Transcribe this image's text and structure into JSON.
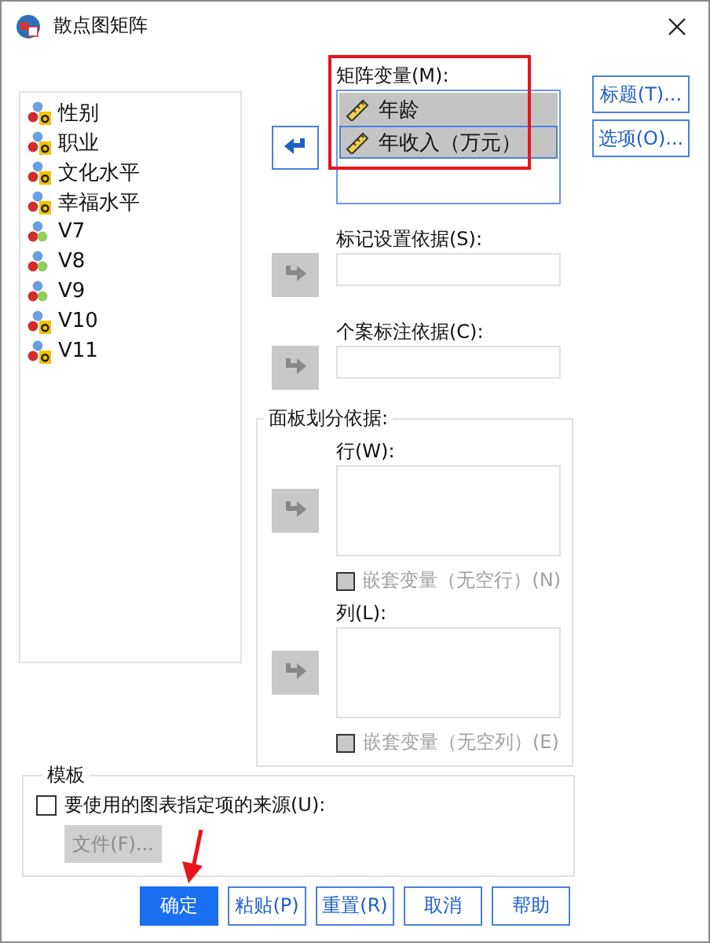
{
  "window": {
    "title": "散点图矩阵"
  },
  "variables": [
    {
      "name": "性别",
      "kind": "string"
    },
    {
      "name": "职业",
      "kind": "string"
    },
    {
      "name": "文化水平",
      "kind": "string"
    },
    {
      "name": "幸福水平",
      "kind": "string"
    },
    {
      "name": "V7",
      "kind": "nominal"
    },
    {
      "name": "V8",
      "kind": "nominal"
    },
    {
      "name": "V9",
      "kind": "nominal"
    },
    {
      "name": "V10",
      "kind": "string"
    },
    {
      "name": "V11",
      "kind": "string"
    }
  ],
  "matrix_variables": {
    "label": "矩阵变量(M):",
    "move_enabled": true,
    "items": [
      {
        "name": "年龄",
        "kind": "scale",
        "selected": true,
        "focused": false
      },
      {
        "name": "年收入（万元）",
        "kind": "scale",
        "selected": true,
        "focused": true
      }
    ]
  },
  "marker": {
    "label": "标记设置依据(S):",
    "move_enabled": false
  },
  "case_label": {
    "label": "个案标注依据(C):",
    "move_enabled": false
  },
  "panel": {
    "title": "面板划分依据:",
    "sections": [
      {
        "label": "行(W):",
        "move_enabled": false,
        "nest": {
          "label": "嵌套变量（无空行）(N)",
          "checked": false,
          "disabled": true
        }
      },
      {
        "label": "列(L):",
        "move_enabled": false,
        "nest": {
          "label": "嵌套变量（无空列）(E)",
          "checked": false,
          "disabled": true
        }
      }
    ]
  },
  "side_buttons": [
    "标题(T)...",
    "选项(O)..."
  ],
  "template": {
    "title": "模板",
    "use": {
      "label": "要使用的图表指定项的来源(U):",
      "checked": false
    },
    "file_button": {
      "label": "文件(F)...",
      "disabled": true
    }
  },
  "buttons": [
    {
      "label": "确定",
      "primary": true
    },
    {
      "label": "粘贴(P)",
      "primary": false
    },
    {
      "label": "重置(R)",
      "primary": false
    },
    {
      "label": "取消",
      "primary": false
    },
    {
      "label": "帮助",
      "primary": false
    }
  ]
}
